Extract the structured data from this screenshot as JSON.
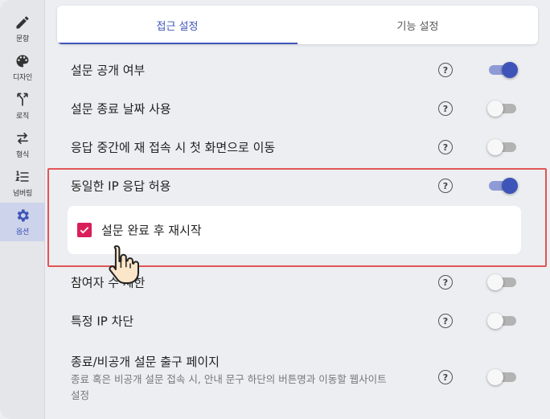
{
  "sidebar": {
    "items": [
      {
        "label": "문항",
        "icon": "pencil-icon"
      },
      {
        "label": "디자인",
        "icon": "palette-icon"
      },
      {
        "label": "로직",
        "icon": "merge-arrow-icon"
      },
      {
        "label": "형식",
        "icon": "swap-arrows-icon"
      },
      {
        "label": "넘버링",
        "icon": "numbered-list-icon"
      },
      {
        "label": "옵션",
        "icon": "gear-icon",
        "active": true
      }
    ]
  },
  "tabs": [
    {
      "label": "접근 설정",
      "active": true
    },
    {
      "label": "기능 설정",
      "active": false
    }
  ],
  "settings": [
    {
      "label": "설문 공개 여부",
      "on": true
    },
    {
      "label": "설문 종료 날짜 사용",
      "on": false
    },
    {
      "label": "응답 중간에 재 접속 시 첫 화면으로 이동",
      "on": false
    },
    {
      "label": "동일한 IP 응답 허용",
      "on": true
    },
    {
      "label": "참여자 수 제한",
      "on": false
    },
    {
      "label": "특정 IP 차단",
      "on": false
    },
    {
      "label": "종료/비공개 설문 출구 페이지",
      "description": "종료 혹은 비공개 설문 접속 시, 안내 문구 하단의 버튼명과 이동할 웹사이트 설정",
      "on": false
    }
  ],
  "sub_option": {
    "label": "설문 완료 후 재시작",
    "checked": true
  },
  "help_glyph": "?",
  "colors": {
    "accent": "#3e54b8",
    "accent_track": "#8f9bd6",
    "checkbox": "#d91f5a",
    "highlight_border": "#e05555"
  }
}
